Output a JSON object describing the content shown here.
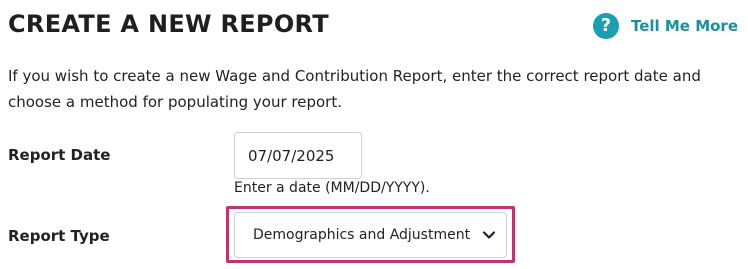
{
  "header": {
    "title": "CREATE A NEW REPORT",
    "help_icon": "question-circle-icon",
    "help_icon_glyph": "?",
    "help_label": "Tell Me More",
    "accent_color": "#1a9fb0"
  },
  "intro": {
    "text": "If you wish to create a new Wage and Contribution Report, enter the correct report date and choose a method for populating your report."
  },
  "form": {
    "report_date": {
      "label": "Report Date",
      "value": "07/07/2025",
      "hint": "Enter a date (MM/DD/YYYY)."
    },
    "report_type": {
      "label": "Report Type",
      "selected": "Demographics and Adjustment",
      "icon": "chevron-down-icon",
      "focus_color": "#c0336e"
    }
  }
}
